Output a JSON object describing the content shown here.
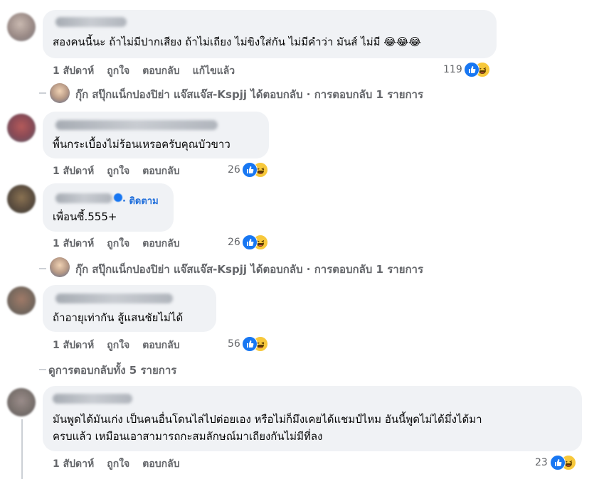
{
  "comments": [
    {
      "text": "สองคนนี้นะ ถ้าไม่มีปากเสียง ถ้าไม่เถียง ไม่ขิงใส่กัน ไม่มีคำว่า มันส์ ไม่มี 😂😂😂",
      "time": "1 สัปดาห์",
      "like": "ถูกใจ",
      "reply": "ตอบกลับ",
      "edited": "แก้ไขแล้ว",
      "reactions": "119"
    },
    {
      "text": "พื้นกระเบื้องไม่ร้อนเหรอครับคุณบัวขาว",
      "time": "1 สัปดาห์",
      "like": "ถูกใจ",
      "reply": "ตอบกลับ",
      "reactions": "26"
    },
    {
      "follow": "· ติดตาม",
      "text": "เพื่อนซี้.555+",
      "time": "1 สัปดาห์",
      "like": "ถูกใจ",
      "reply": "ตอบกลับ",
      "reactions": "26"
    },
    {
      "text": "ถ้าอายุเท่ากัน สู้แสนชัยไม่ได้",
      "time": "1 สัปดาห์",
      "like": "ถูกใจ",
      "reply": "ตอบกลับ",
      "reactions": "56"
    },
    {
      "text_line1": "มันพูดได้มันเก่ง เป็นคนอื่นโดนไล่ไปต่อยเอง หรือไม่ก็มึงเคยได้แชมป์ไหม อันนี้พูดไม่ได้มึ่งได้มา",
      "text_line2": "ครบแล้ว เหมือนเอาสามารถกะสมลักษณ์มาเถียงกันไม่มีที่ลง",
      "time": "1 สัปดาห์",
      "like": "ถูกใจ",
      "reply": "ตอบกลับ",
      "reactions": "23"
    }
  ],
  "reply_summary_1": "กุ๊ก สปุ๊กแน็กปองปิย่า แจ๊สแจ๊ส-Kspjj ได้ตอบกลับ · การตอบกลับ 1 รายการ",
  "reply_summary_2": "กุ๊ก สปุ๊กแน็กปองปิย่า แจ๊สแจ๊ส-Kspjj ได้ตอบกลับ · การตอบกลับ 1 รายการ",
  "view_all_replies": "ดูการตอบกลับทั้ง 5 รายการ",
  "colors": {
    "like_blue": "#1877f2",
    "haha_yellow": "#f7c83b",
    "bubble": "#f0f2f5",
    "meta_gray": "#65676b",
    "follow_blue": "#216fdb"
  },
  "icons": [
    "like-reaction-icon",
    "haha-reaction-icon"
  ]
}
